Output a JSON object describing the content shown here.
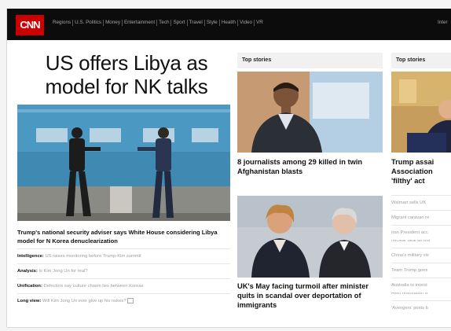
{
  "brand": {
    "logo_text": "CNN",
    "accent_color": "#cc0000"
  },
  "nav": {
    "links": [
      "Regions",
      "U.S. Politics",
      "Money",
      "Entertainment",
      "Tech",
      "Sport",
      "Travel",
      "Style",
      "Health",
      "Video",
      "VR"
    ],
    "more_label": "Inter"
  },
  "lead_story": {
    "headline": "US offers Libya as model for NK talks",
    "caption": "Trump's national security adviser says White House considering Libya model for N Korea denuclearization",
    "bullets": [
      {
        "label": "Intelligence:",
        "text": "US raises monitoring before Trump-Kim summit"
      },
      {
        "label": "Analysis:",
        "text": "Is Kim Jong Un for real?"
      },
      {
        "label": "Unification:",
        "text": "Defectors say culture chasm lies between Koreas"
      },
      {
        "label": "Long view:",
        "text": "Will Kim Jong Un ever give up his nukes?"
      }
    ]
  },
  "top_stories": {
    "heading": "Top stories",
    "story1": {
      "title": "8 journalists among 29 killed in twin Afghanistan blasts"
    },
    "story2": {
      "title": "UK's May facing turmoil after minister quits in scandal over deportation of immigrants"
    }
  },
  "right_column": {
    "heading": "Top stories",
    "title_lines": [
      "Trump assai",
      "Association",
      "'filthy' act"
    ],
    "items": [
      "Walmart sells UK",
      "Migrant caravan re",
      "Iran President acc",
      "nuclear deal as Ma",
      "China's military vis",
      "Team Trump goes",
      "Australia to invest",
      "Reef restoration a",
      "'Avengers' posts b"
    ]
  }
}
